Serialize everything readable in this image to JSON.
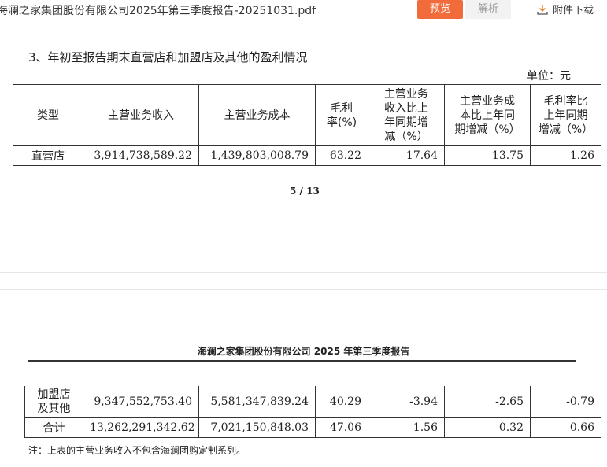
{
  "topbar": {
    "file_title": "海澜之家集团股份有限公司2025年第三季度报告-20251031.pdf",
    "preview_label": "预览",
    "parse_label": "解析",
    "download_label": "附件下载"
  },
  "section": {
    "heading": "3、年初至报告期末直营店和加盟店及其他的盈利情况",
    "unit": "单位：元"
  },
  "table": {
    "headers": [
      "类型",
      "主营业务收入",
      "主营业务成本",
      "毛利率（%）",
      "主营业务收入比上年同期增减（%）",
      "主营业务成本比上年同期增减（%）",
      "毛利率比上年同期增减（%）"
    ],
    "header_display": {
      "h3": "毛利\n率(%)",
      "h4": "主营业务\n收入比上\n年同期增\n减（%）",
      "h5": "主营业务成\n本比上年同\n期增减（%）",
      "h6": "毛利率比\n上年同期\n增减（%）"
    },
    "rows": [
      [
        "直营店",
        "3,914,738,589.22",
        "1,439,803,008.79",
        "63.22",
        "17.64",
        "13.75",
        "1.26"
      ],
      [
        "加盟店及其他",
        "9,347,552,753.40",
        "5,581,347,839.24",
        "40.29",
        "-3.94",
        "-2.65",
        "-0.79"
      ],
      [
        "合计",
        "13,262,291,342.62",
        "7,021,150,848.03",
        "47.06",
        "1.56",
        "0.32",
        "0.66"
      ]
    ],
    "row2_label_lines": [
      "加盟店",
      "及其他"
    ]
  },
  "page": {
    "number": "5 / 13"
  },
  "page_header": "海澜之家集团股份有限公司 2025 年第三季度报告",
  "note": "注：上表的主营业务收入不包含海澜团购定制系列。",
  "colors": {
    "preview_bg": "#f26b3a",
    "parse_bg": "#f2f2f2"
  },
  "icons": {
    "download": "download-icon"
  }
}
